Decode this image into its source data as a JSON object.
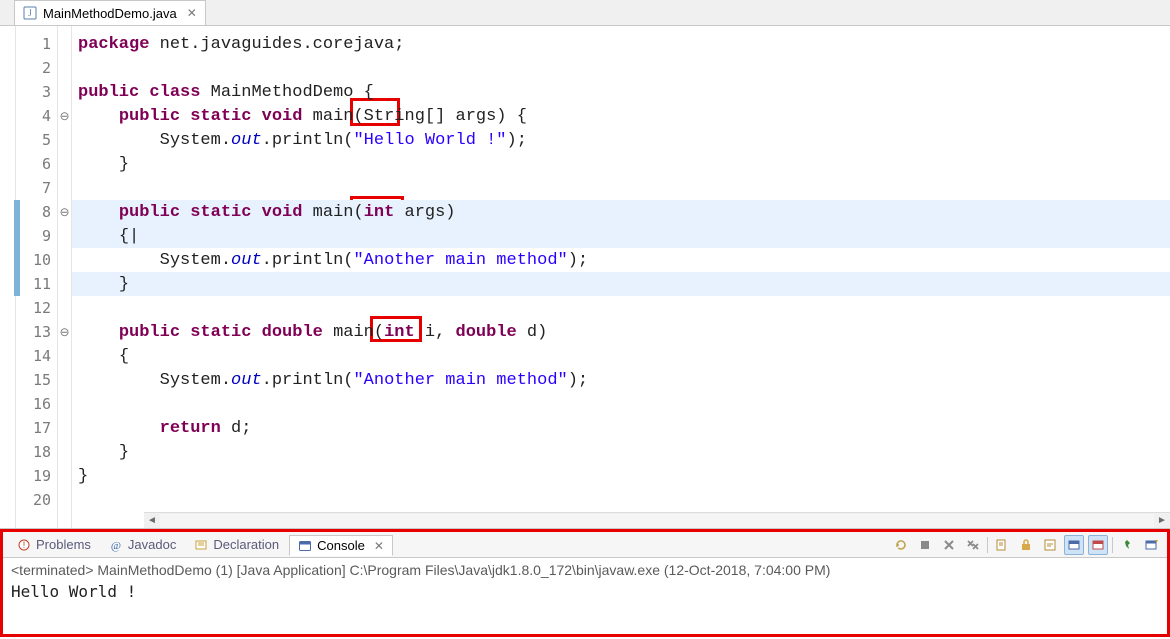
{
  "editor": {
    "tab": {
      "filename": "MainMethodDemo.java",
      "close_glyph": "✕"
    },
    "lines": [
      {
        "n": "1",
        "fold": "",
        "hl": false
      },
      {
        "n": "2",
        "fold": "",
        "hl": false
      },
      {
        "n": "3",
        "fold": "",
        "hl": false
      },
      {
        "n": "4",
        "fold": "⊖",
        "hl": false
      },
      {
        "n": "5",
        "fold": "",
        "hl": false
      },
      {
        "n": "6",
        "fold": "",
        "hl": false
      },
      {
        "n": "7",
        "fold": "",
        "hl": false
      },
      {
        "n": "8",
        "fold": "⊖",
        "hl": true
      },
      {
        "n": "9",
        "fold": "",
        "hl": true
      },
      {
        "n": "10",
        "fold": "",
        "hl": false
      },
      {
        "n": "11",
        "fold": "",
        "hl": true
      },
      {
        "n": "12",
        "fold": "",
        "hl": false
      },
      {
        "n": "13",
        "fold": "⊖",
        "hl": false
      },
      {
        "n": "14",
        "fold": "",
        "hl": false
      },
      {
        "n": "15",
        "fold": "",
        "hl": false
      },
      {
        "n": "16",
        "fold": "",
        "hl": false
      },
      {
        "n": "17",
        "fold": "",
        "hl": false
      },
      {
        "n": "18",
        "fold": "",
        "hl": false
      },
      {
        "n": "19",
        "fold": "",
        "hl": false
      },
      {
        "n": "20",
        "fold": "",
        "hl": false
      }
    ],
    "code": {
      "l1": {
        "kw1": "package",
        "rest": " net.javaguides.corejava;"
      },
      "l3": {
        "kw1": "public",
        "kw2": "class",
        "cls": " MainMethodDemo ",
        "brace": "{"
      },
      "l4": {
        "indent": "    ",
        "kw1": "public",
        "kw2": "static",
        "kw3": "void",
        "m": " main",
        "sig": "(String[] args) {"
      },
      "l5": {
        "indent": "        ",
        "sys": "System.",
        "out": "out",
        "call": ".println(",
        "str": "\"Hello World !\"",
        "end": ");"
      },
      "l6": {
        "indent": "    ",
        "brace": "}"
      },
      "l8": {
        "indent": "    ",
        "kw1": "public",
        "kw2": "static",
        "kw3": "void",
        "m": " main",
        "sig": "(",
        "kw4": "int",
        "sig2": " args)"
      },
      "l9": {
        "indent": "    ",
        "brace": "{"
      },
      "l10": {
        "indent": "        ",
        "sys": "System.",
        "out": "out",
        "call": ".println(",
        "str": "\"Another main method\"",
        "end": ");"
      },
      "l11": {
        "indent": "    ",
        "brace": "}"
      },
      "l13": {
        "indent": "    ",
        "kw1": "public",
        "kw2": "static",
        "kw3": "double",
        "m": " main",
        "sig": "(",
        "kw4": "int",
        "mid": " i, ",
        "kw5": "double",
        "sig2": " d)"
      },
      "l14": {
        "indent": "    ",
        "brace": "{"
      },
      "l15": {
        "indent": "        ",
        "sys": "System.",
        "out": "out",
        "call": ".println(",
        "str": "\"Another main method\"",
        "end": ");"
      },
      "l17": {
        "indent": "        ",
        "kw1": "return",
        "rest": " d;"
      },
      "l18": {
        "indent": "    ",
        "brace": "}"
      },
      "l19": {
        "brace": "}"
      }
    },
    "caret": "|"
  },
  "bottom": {
    "tabs": {
      "problems": "Problems",
      "javadoc": "Javadoc",
      "declaration": "Declaration",
      "console": "Console"
    },
    "console_close_glyph": "✕",
    "terminated_line": "<terminated> MainMethodDemo (1) [Java Application] C:\\Program Files\\Java\\jdk1.8.0_172\\bin\\javaw.exe (12-Oct-2018, 7:04:00 PM)",
    "output": "Hello World !"
  }
}
